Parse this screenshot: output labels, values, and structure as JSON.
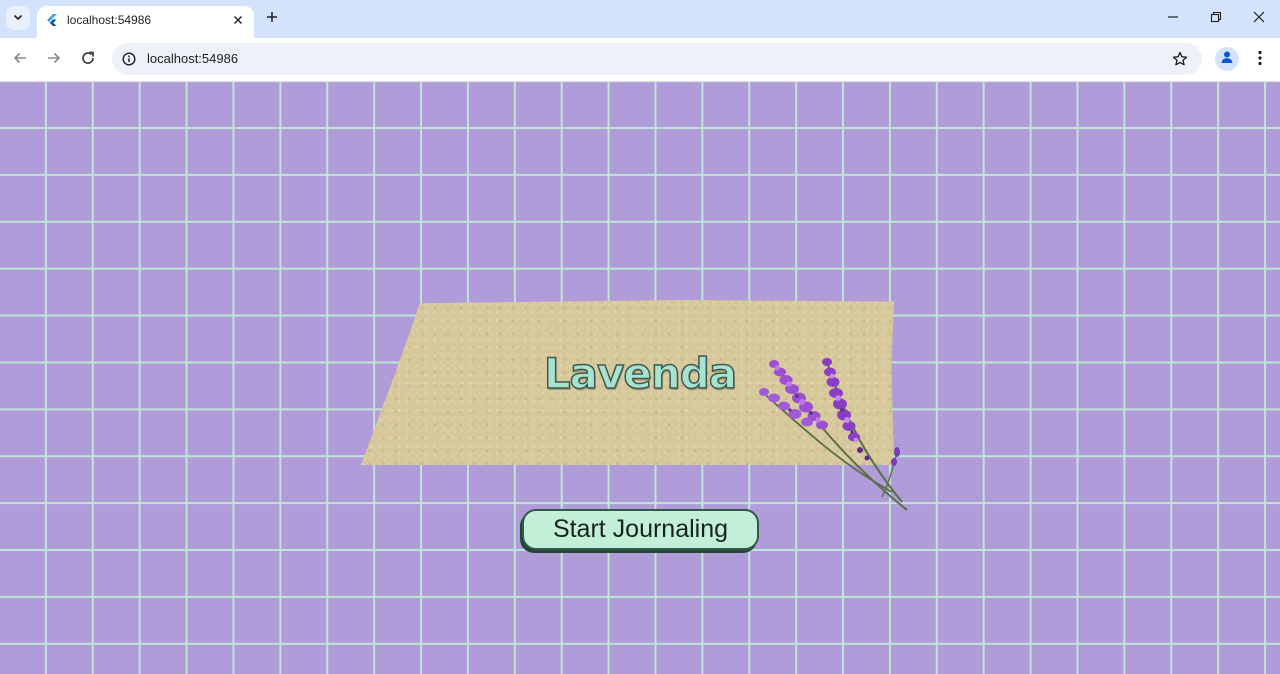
{
  "browser": {
    "tab": {
      "title": "localhost:54986",
      "favicon": "flutter-icon"
    },
    "omnibox": {
      "url": "localhost:54986"
    },
    "icons": {
      "tab_search": "chevron-down-icon",
      "tab_close": "close-icon",
      "new_tab": "plus-icon",
      "minimize": "minimize-icon",
      "restore": "restore-icon",
      "close_window": "close-icon",
      "back": "back-arrow-icon",
      "forward": "forward-arrow-icon",
      "reload": "reload-icon",
      "site_info": "info-icon",
      "bookmark": "star-icon",
      "profile": "person-icon",
      "menu": "more-vert-icon"
    }
  },
  "page": {
    "title": "Lavenda",
    "start_button_label": "Start Journaling",
    "colors": {
      "background": "#b19cda",
      "grid_lines": "#bfe4d8",
      "tape": "#d6c89a",
      "title_fill": "#a8e3cf",
      "button_fill": "#c3efd8",
      "button_border": "#2f5a45"
    },
    "decoration": "lavender-sprig-illustration"
  }
}
